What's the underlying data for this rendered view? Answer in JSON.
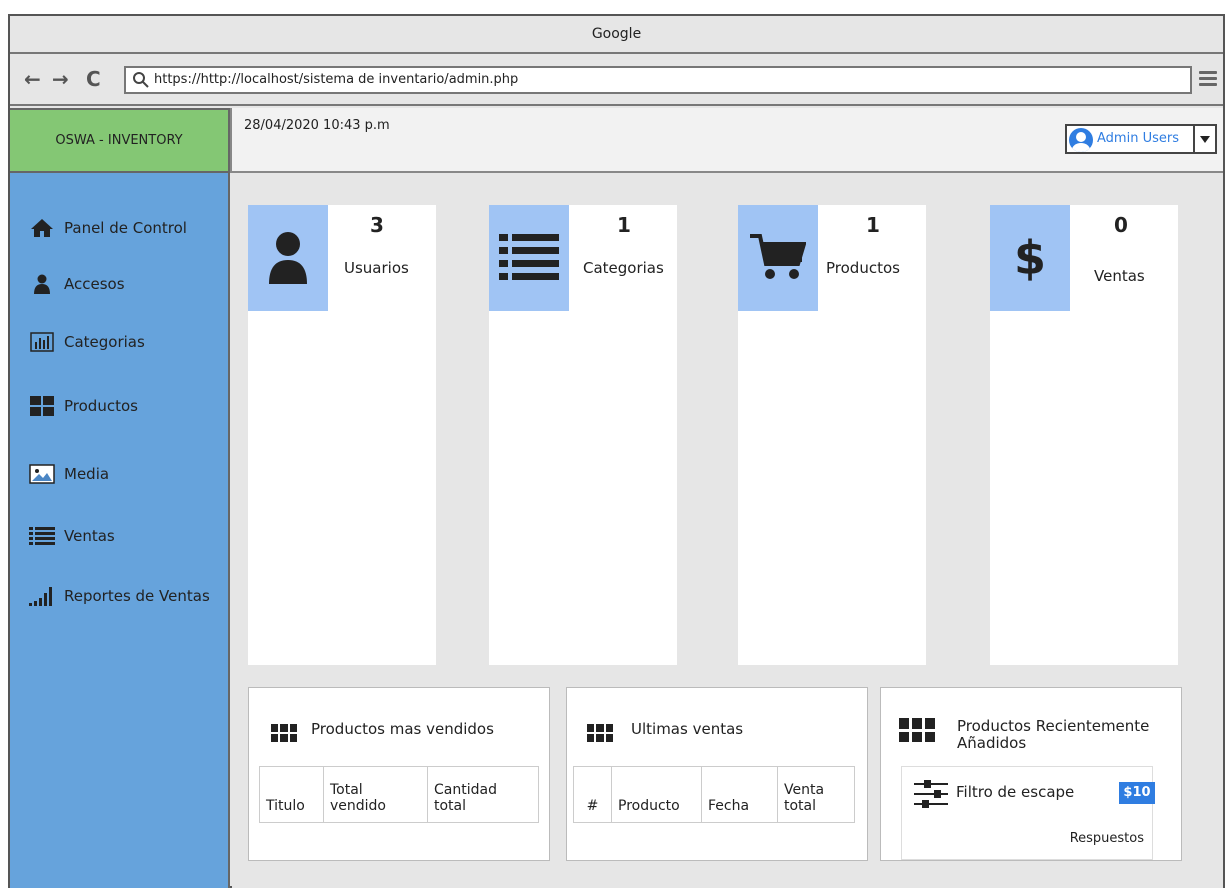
{
  "browser": {
    "title": "Google",
    "url": "https://http://localhost/sistema de inventario/admin.php",
    "back_icon": "←",
    "forward_icon": "→",
    "reload_icon": "C"
  },
  "app": {
    "brand": "OSWA - INVENTORY",
    "datetime": "28/04/2020 10:43 p.m",
    "user_label": "Admin Users"
  },
  "sidebar": {
    "items": [
      {
        "label": "Panel de Control",
        "icon": "home-icon"
      },
      {
        "label": "Accesos",
        "icon": "user-icon"
      },
      {
        "label": "Categorias",
        "icon": "bar-chart-icon"
      },
      {
        "label": "Productos",
        "icon": "grid-icon"
      },
      {
        "label": "Media",
        "icon": "image-icon"
      },
      {
        "label": "Ventas",
        "icon": "list-icon"
      },
      {
        "label": "Reportes de Ventas",
        "icon": "signal-bars-icon"
      }
    ]
  },
  "stats": [
    {
      "value": "3",
      "label": "Usuarios",
      "icon": "user-icon"
    },
    {
      "value": "1",
      "label": "Categorias",
      "icon": "list-icon"
    },
    {
      "value": "1",
      "label": "Productos",
      "icon": "cart-icon"
    },
    {
      "value": "0",
      "label": "Ventas",
      "icon": "dollar-icon"
    }
  ],
  "panels": {
    "best_sellers": {
      "title": "Productos mas vendidos",
      "columns": [
        "Titulo",
        "Total vendido",
        "Cantidad total"
      ]
    },
    "latest_sales": {
      "title": "Ultimas ventas",
      "columns": [
        "#",
        "Producto",
        "Fecha",
        "Venta total"
      ]
    },
    "recent_products": {
      "title": "Productos Recientemente Añadidos",
      "item": {
        "name": "Filtro de escape",
        "price": "$10",
        "category": "Respuestos"
      }
    }
  },
  "colors": {
    "sidebar": "#66a3dc",
    "brand": "#84c774",
    "tile": "#a0c4f4",
    "accent": "#2f7de1"
  }
}
